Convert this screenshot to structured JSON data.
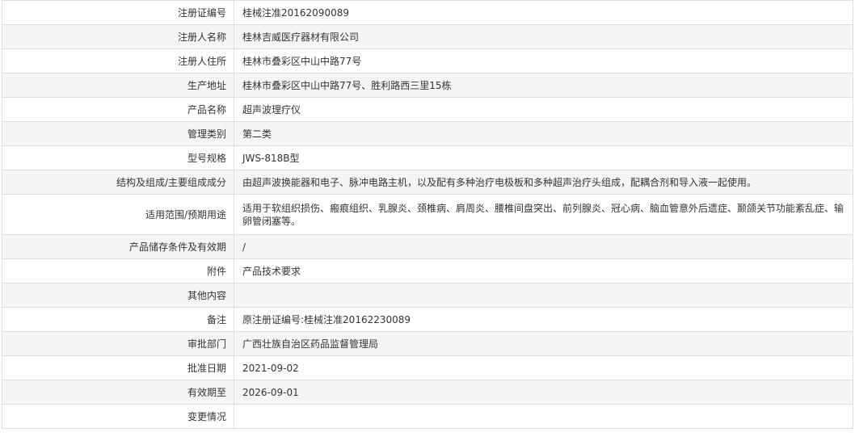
{
  "rows": [
    {
      "label": "注册证编号",
      "value": "桂械注准20162090089"
    },
    {
      "label": "注册人名称",
      "value": "桂林吉威医疗器材有限公司"
    },
    {
      "label": "注册人住所",
      "value": "桂林市叠彩区中山中路77号"
    },
    {
      "label": "生产地址",
      "value": "桂林市叠彩区中山中路77号、胜利路西三里15栋"
    },
    {
      "label": "产品名称",
      "value": "超声波理疗仪"
    },
    {
      "label": "管理类别",
      "value": "第二类"
    },
    {
      "label": "型号规格",
      "value": "JWS-818B型"
    },
    {
      "label": "结构及组成/主要组成成分",
      "value": "由超声波换能器和电子、脉冲电路主机，以及配有多种治疗电极板和多种超声治疗头组成，配耦合剂和导入液一起使用。"
    },
    {
      "label": "适用范围/预期用途",
      "value": "适用于软组织损伤、瘢痕组织、乳腺炎、颈椎病、肩周炎、腰椎间盘突出、前列腺炎、冠心病、脑血管意外后遗症、颞颌关节功能紊乱症、输卵管闭塞等。"
    },
    {
      "label": "产品储存条件及有效期",
      "value": "/"
    },
    {
      "label": "附件",
      "value": "产品技术要求"
    },
    {
      "label": "其他内容",
      "value": ""
    },
    {
      "label": "备注",
      "value": "原注册证编号:桂械注准20162230089"
    },
    {
      "label": "审批部门",
      "value": "广西壮族自治区药品监督管理局"
    },
    {
      "label": "批准日期",
      "value": "2021-09-02"
    },
    {
      "label": "有效期至",
      "value": "2026-09-01"
    },
    {
      "label": "变更情况",
      "value": ""
    }
  ]
}
